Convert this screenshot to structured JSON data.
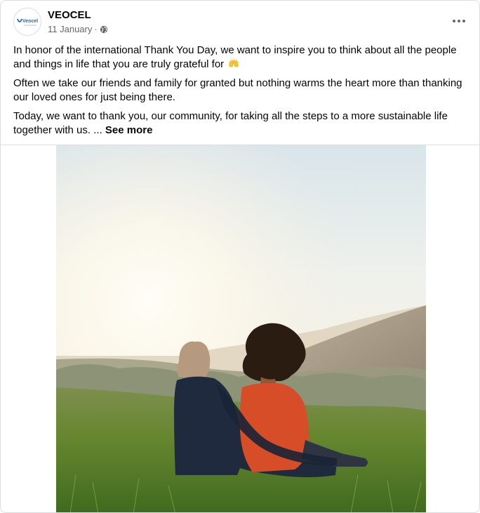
{
  "post": {
    "page_name": "VEOCEL",
    "avatar_logo_text": "Veocel",
    "date": "11 January",
    "separator": "·",
    "paragraphs": [
      "In honor of the international Thank You Day, we want to inspire you to think about all the people and things in life that you are truly grateful for",
      "Often we take our friends and family for granted but nothing warms the heart more than thanking our loved ones for just being there.",
      "Today, we want to thank you, our community, for taking all the steps to a more sustainable life together with us. ..."
    ],
    "emoji_icon": "raising-hands-emoji",
    "see_more_label": "See more",
    "privacy_icon": "globe-icon",
    "options_icon": "more-horizontal-icon"
  },
  "colors": {
    "text": "#050505",
    "meta": "#65676b",
    "border": "#dadde1",
    "brand_blue": "#1d6fb8"
  }
}
